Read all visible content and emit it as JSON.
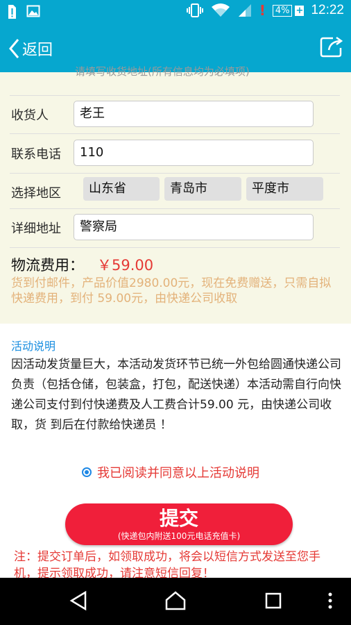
{
  "status_bar": {
    "icons_left": [
      "sim-alert-icon",
      "image-icon"
    ],
    "battery_percent": "4%",
    "time": "12:22"
  },
  "nav": {
    "back_label": "返回",
    "share_icon": "share-icon"
  },
  "form": {
    "cut_text": "请填写收货地址(所有信息均为必填项)",
    "fields": [
      {
        "label": "收货人",
        "value": "老王"
      },
      {
        "label": "联系电话",
        "value": "110"
      },
      {
        "label": "选择地区",
        "values": [
          "山东省",
          "青岛市",
          "平度市"
        ]
      },
      {
        "label": "详细地址",
        "value": "警察局"
      }
    ],
    "fee_label": "物流费用：",
    "fee_value": "￥59.00",
    "fee_desc": "货到付邮件，产品价值2980.00元，现在免费赠送，只需自拟快递费用，到付 59.00元，由快递公司收取"
  },
  "activity": {
    "title": "活动说明",
    "body": "因活动发货量巨大，本活动发货环节已统一外包给圆通快递公司负责（包括仓储，包装盒，打包，配送快递）本活动需自行向快递公司支付到付快递费及人工费合计59.00 元，由快递公司收取，货 到后在付款给快递员 ！"
  },
  "agreement": {
    "checked": true,
    "text": "我已阅读并同意以上活动说明"
  },
  "submit": {
    "label": "提交",
    "sublabel": "(快递包内附送100元电话充值卡)"
  },
  "note": "注：提交订单后，如领取成功，将会以短信方式发送至您手机，提示领取成功，请注意短信回复！",
  "colors": {
    "header": "#06a7cf",
    "form_bg": "#f7f7e6",
    "accent_red": "#f01f3a",
    "fee_desc": "#e3b27a",
    "link_blue": "#1a8ee0"
  }
}
